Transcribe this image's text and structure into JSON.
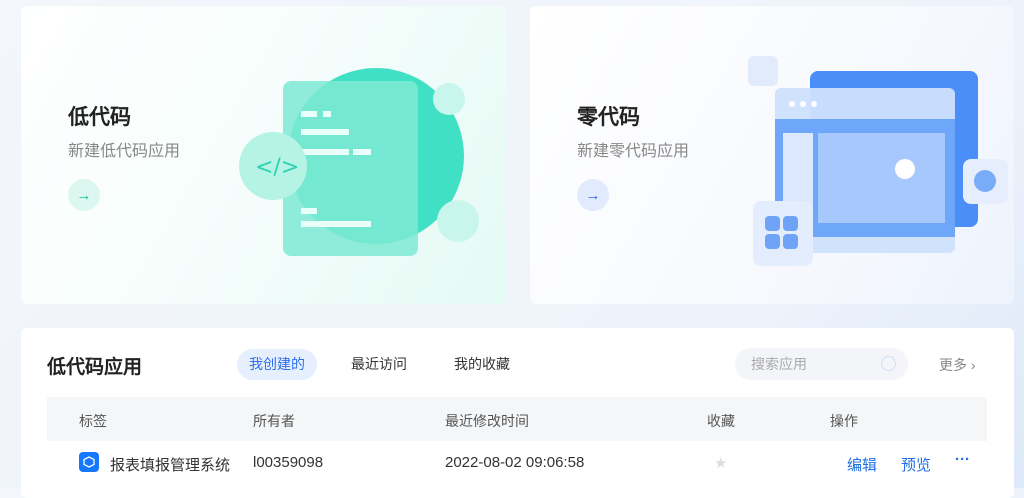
{
  "cards": [
    {
      "title": "低代码",
      "subtitle": "新建低代码应用",
      "arrow": "→"
    },
    {
      "title": "零代码",
      "subtitle": "新建零代码应用",
      "arrow": "→"
    }
  ],
  "panel": {
    "title": "低代码应用",
    "tabs": [
      "我创建的",
      "最近访问",
      "我的收藏"
    ],
    "search_placeholder": "搜索应用",
    "more": "更多 ›",
    "columns": [
      "标签",
      "所有者",
      "最近修改时间",
      "收藏",
      "操作"
    ],
    "rows": [
      {
        "name": "报表填报管理系统",
        "owner": "l00359098",
        "modified": "2022-08-02 09:06:58",
        "starred": false,
        "actions": [
          "编辑",
          "预览",
          "···"
        ]
      }
    ]
  },
  "colors": {
    "accent": "#1f6fe8",
    "teal": "#14c29b"
  }
}
